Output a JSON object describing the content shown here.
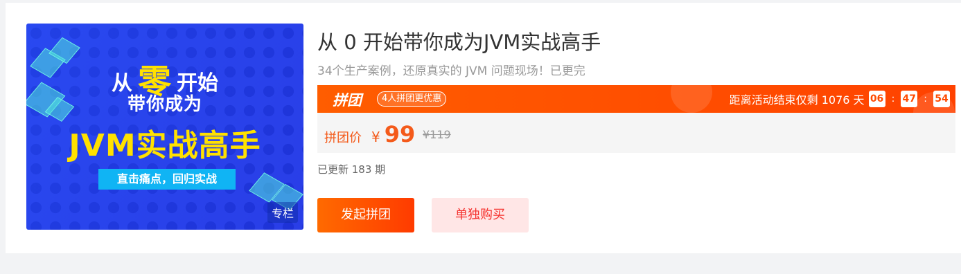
{
  "course": {
    "title": "从 0 开始带你成为JVM实战高手",
    "subtitle": "34个生产案例，还原真实的 JVM 问题现场！已更完",
    "cover": {
      "line1_prefix": "从",
      "line1_zero": "零",
      "line1_suffix": "开始",
      "line2": "带你成为",
      "line3": "JVM实战高手",
      "tag": "直击痛点，回归实战",
      "badge": "专栏"
    }
  },
  "promo": {
    "logo": "拼团",
    "tag": "4人拼团更优惠",
    "countdown_label": "距离活动结束仅剩 1076 天",
    "hours": "06",
    "minutes": "47",
    "seconds": "54",
    "separator": ":",
    "colors": {
      "bar_start": "#ff5d00",
      "bar_end": "#ff4200"
    }
  },
  "price": {
    "label": "拼团价",
    "currency": "¥",
    "current": "99",
    "original": "¥119"
  },
  "updates": "已更新 183 期",
  "buttons": {
    "group_buy": "发起拼团",
    "solo_buy": "单独购买"
  }
}
